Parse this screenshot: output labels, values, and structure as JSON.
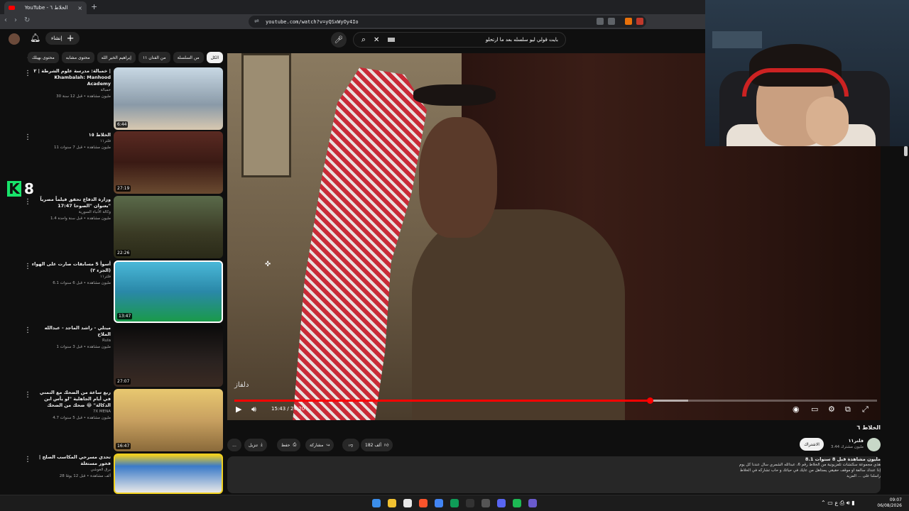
{
  "browser": {
    "tab_title": "YouTube - الخلاط ٦",
    "url": "youtube.com/watch?v=yQSxWyOy4Io",
    "new_tab": "+",
    "tab_close": "×"
  },
  "header": {
    "create_label": "إنشاء",
    "search_query": "بايت قولي ليو سلسله بعد ما ارتحلو"
  },
  "chips": [
    {
      "label": "الكل",
      "active": true
    },
    {
      "label": "من السلسلة"
    },
    {
      "label": "من الفنان ١١"
    },
    {
      "label": "إبراهيم الخير الله"
    },
    {
      "label": "محتوى مشابه"
    },
    {
      "label": "محتوى بهيلك"
    }
  ],
  "recommendations": [
    {
      "title": "خمبالة: مدرسة علوم الشرطة | ٢ | Khambalah: Manhood Academy",
      "channel": "خمبالة",
      "meta": "30 مليون مشاهدة • قبل 12 سنة",
      "duration": "6:44",
      "color": "#b8c8d4"
    },
    {
      "title": "الخلاط ١٥",
      "channel": "فلتر١١",
      "meta": "11 مليون مشاهدة • قبل 7 سنوات",
      "duration": "27:19",
      "color": "#6a2a22"
    },
    {
      "title": "وزارة الدفاع تحقق فيلماً مصرياً بعنوان \"الصوحا 17:47\"",
      "channel": "وكالة الأنباء السورية",
      "meta": "1.4 مليون مشاهدة • قبل سنة واحدة",
      "duration": "22:26",
      "color": "#3a3a24"
    },
    {
      "title": "أسوأ 5 مسابقات صارت على الهواء (الجزء ٢)",
      "channel": "فلتر١١",
      "meta": "6.1 مليون مشاهدة • قبل 6 سنوات",
      "duration": "13:47",
      "color": "#3aa8c8"
    },
    {
      "title": "ميتلي - راشد الماجد - عبدالله الملاح",
      "channel": "Rula",
      "meta": "1 مليون مشاهدة • قبل 3 سنوات",
      "duration": "27:07",
      "color": "#1a1a1a"
    },
    {
      "title": "ربع ساعة من الضحك مع التمني في أيام الجاهلية \"لو يأس ابن الدكالة\" 😂 ضحك من الضحك",
      "channel": "7X MENA",
      "meta": "4.7 مليون مشاهدة • قبل 5 سنوات",
      "duration": "16:47",
      "color": "#c8a060"
    },
    {
      "title": "تحدي مسرحي المكاسب الصلح | فخور مستغلة",
      "channel": "برق الغوشي",
      "meta": "28 ألف مشاهدة • قبل 12 يومًا",
      "duration": "",
      "color": "#3a7ac8"
    }
  ],
  "overlay": {
    "k_letter": "K",
    "k_number": "8"
  },
  "player": {
    "watermark": "دلفاز",
    "current_time": "15:43",
    "duration": "24:20",
    "progress_fraction": 0.646,
    "buffered_fraction": 0.706
  },
  "video": {
    "title": "الخلاط ٦",
    "channel": "فلتر١١",
    "subscribers": "3.44 مليون مشترك",
    "subscribe_label": "الاشتراك",
    "likes": "182 ألف",
    "share": "مشاركة",
    "save": "حفظ",
    "download": "تنزيل",
    "more": "..."
  },
  "description": {
    "header": "8.1 مليون مشاهدة قبل 8 سنوات",
    "line1": "هذي مجموعة سكتشات تلفزيونية من الخلاط رقم 6، عبدالله الشمري سال عندنا كل يوم",
    "line2": "إذا عندك سالفة او موقف حقيقي يستاهل من عايك في حياتك و حاب تشاركه في الخلاط",
    "line3": "راسلنا على ... المزيد"
  },
  "taskbar": {
    "time": "09:07",
    "date": "06/08/2026"
  }
}
